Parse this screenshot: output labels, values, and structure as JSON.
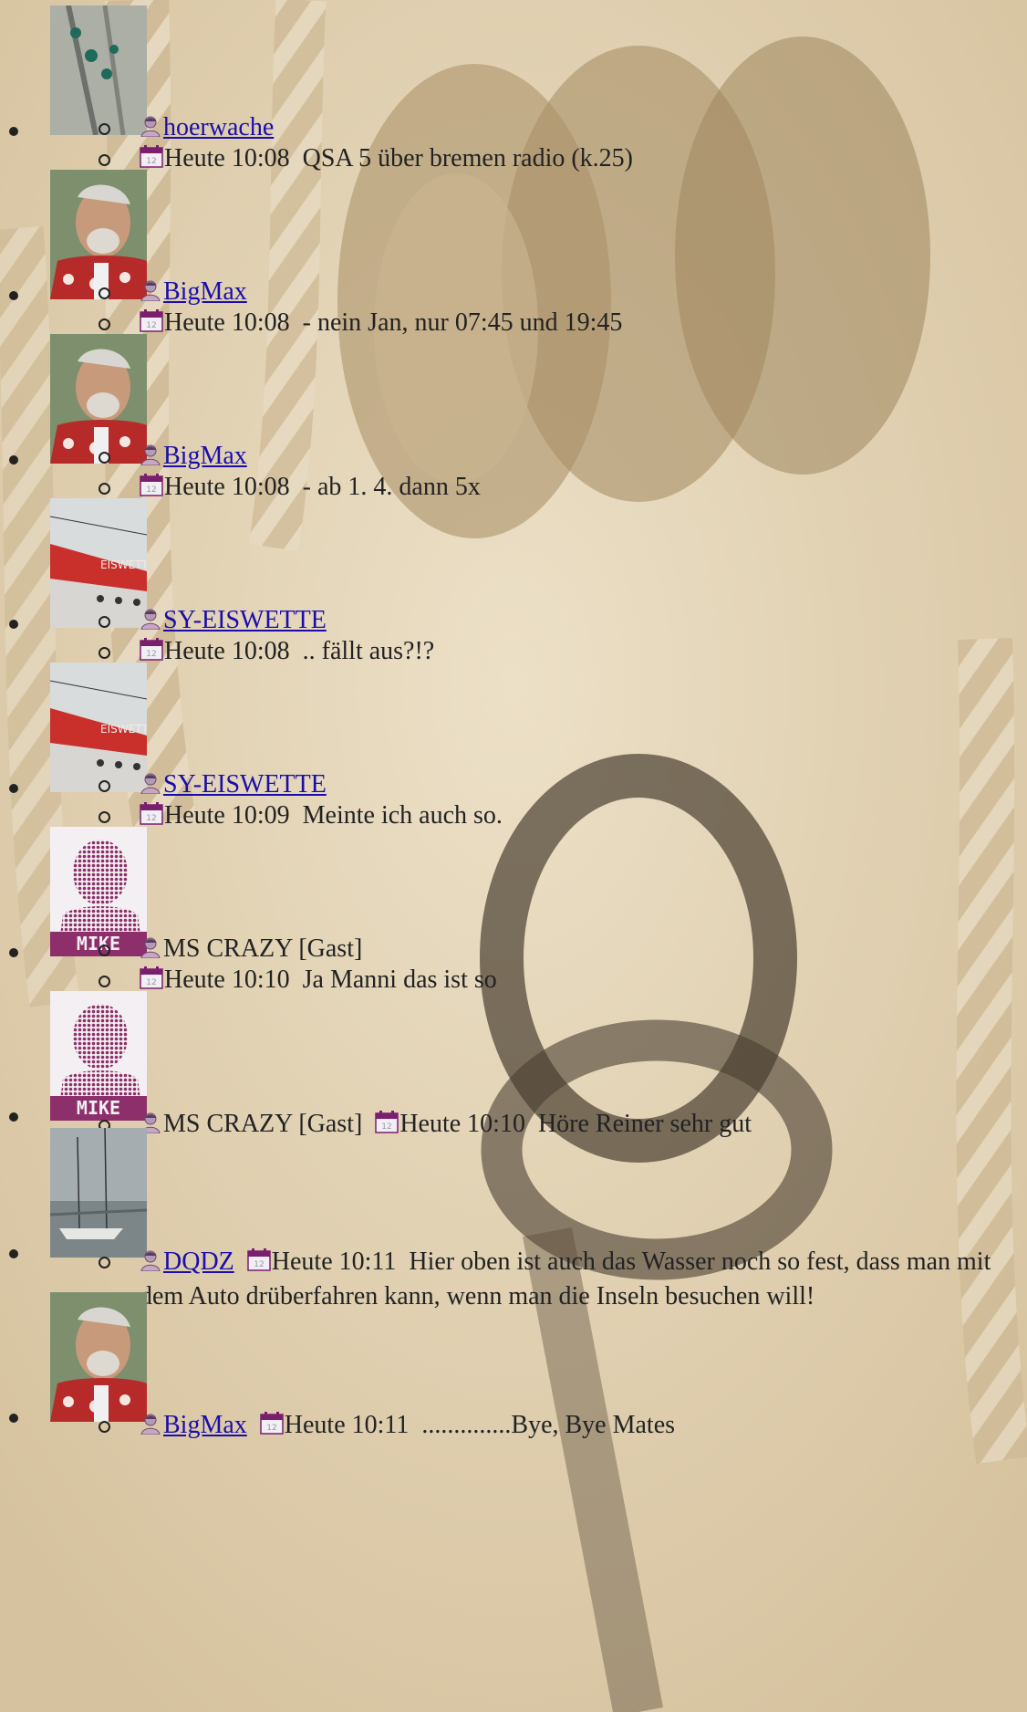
{
  "entries": [
    {
      "avatar": "plant-photo",
      "user": "hoerwache",
      "linked": true,
      "time": "Heute 10:08",
      "message": "QSA 5 über bremen radio (k.25)"
    },
    {
      "avatar": "man-photo",
      "user": "BigMax",
      "linked": true,
      "time": "Heute 10:08",
      "message": "- nein Jan, nur 07:45 und 19:45"
    },
    {
      "avatar": "man-photo",
      "user": "BigMax",
      "linked": true,
      "time": "Heute 10:08",
      "message": "- ab 1. 4. dann 5x"
    },
    {
      "avatar": "boat-photo",
      "user": "SY-EISWETTE",
      "linked": true,
      "time": "Heute 10:08",
      "message": ".. fällt aus?!?"
    },
    {
      "avatar": "boat-photo",
      "user": "SY-EISWETTE",
      "linked": true,
      "time": "Heute 10:09",
      "message": "Meinte ich auch so."
    },
    {
      "avatar": "mike-silhouette",
      "user": "MS CRAZY [Gast]",
      "linked": false,
      "time": "Heute 10:10",
      "message": "Ja Manni das ist so"
    },
    {
      "avatar": "mike-silhouette",
      "user": "MS CRAZY [Gast]",
      "linked": false,
      "time": "Heute 10:10",
      "message": "Höre Reiner sehr gut"
    },
    {
      "avatar": "harbor-photo",
      "user": "DQDZ",
      "linked": true,
      "time": "Heute 10:11",
      "message": "Hier oben ist auch das Wasser noch so fest, dass man mit dem Auto drüberfahren kann, wenn man die Inseln besuchen will!"
    },
    {
      "avatar": "man-photo",
      "user": "BigMax",
      "linked": true,
      "time": "Heute 10:11",
      "message": "..............Bye, Bye Mates"
    }
  ],
  "avatar_text": {
    "mike": "MIKE",
    "boat": "EISWETTE"
  },
  "icons": {
    "user": "user-icon",
    "calendar": "calendar-icon"
  },
  "colors": {
    "link": "#1a0dab",
    "background": "#e2d3b6",
    "calendar": "#7a1f6e"
  }
}
